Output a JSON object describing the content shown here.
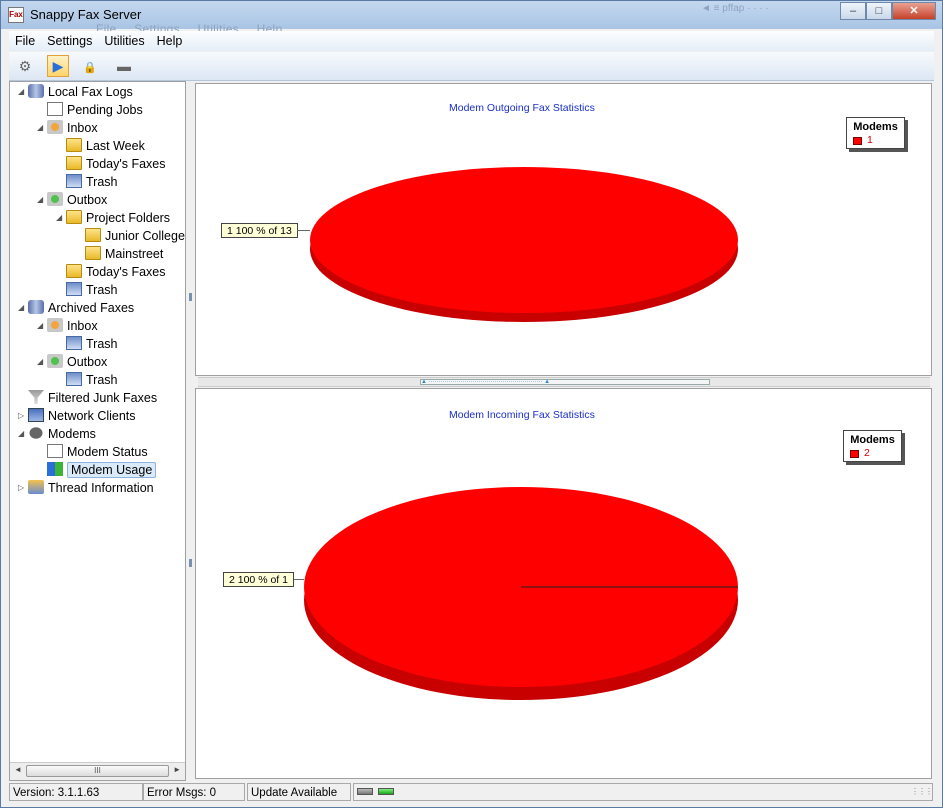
{
  "window": {
    "title": "Snappy Fax Server",
    "app_icon_text": "Fax",
    "ghost_menu": [
      "File",
      "Settings",
      "Utilities",
      "Help"
    ],
    "ghost_top_right": "◄ ≡ pffap   · · · ·",
    "minimize": "–",
    "maximize": "□",
    "close": "✕"
  },
  "menu": [
    "File",
    "Settings",
    "Utilities",
    "Help"
  ],
  "toolbar": {
    "buttons": [
      {
        "icon": "gear-icon",
        "glyph": "⚙"
      },
      {
        "icon": "play-icon",
        "glyph": "▶"
      },
      {
        "icon": "lock-icon",
        "glyph": "🔒"
      },
      {
        "icon": "modem-icon",
        "glyph": "▬"
      }
    ]
  },
  "tree": [
    {
      "label": "Local Fax Logs",
      "icon": "ic-db",
      "depth": 0,
      "exp": "◢"
    },
    {
      "label": "Pending Jobs",
      "icon": "ic-doc",
      "depth": 1,
      "exp": ""
    },
    {
      "label": "Inbox",
      "icon": "ic-inbox",
      "depth": 1,
      "exp": "◢"
    },
    {
      "label": "Last Week",
      "icon": "ic-folder",
      "depth": 2,
      "exp": ""
    },
    {
      "label": "Today's Faxes",
      "icon": "ic-folder",
      "depth": 2,
      "exp": ""
    },
    {
      "label": "Trash",
      "icon": "ic-trash",
      "depth": 2,
      "exp": ""
    },
    {
      "label": "Outbox",
      "icon": "ic-outbox",
      "depth": 1,
      "exp": "◢"
    },
    {
      "label": "Project Folders",
      "icon": "ic-folder",
      "depth": 2,
      "exp": "◢"
    },
    {
      "label": "Junior College",
      "icon": "ic-folder",
      "depth": 3,
      "exp": ""
    },
    {
      "label": "Mainstreet",
      "icon": "ic-folder",
      "depth": 3,
      "exp": ""
    },
    {
      "label": "Today's Faxes",
      "icon": "ic-folder",
      "depth": 2,
      "exp": ""
    },
    {
      "label": "Trash",
      "icon": "ic-trash",
      "depth": 2,
      "exp": ""
    },
    {
      "label": "Archived Faxes",
      "icon": "ic-db",
      "depth": 0,
      "exp": "◢"
    },
    {
      "label": "Inbox",
      "icon": "ic-inbox",
      "depth": 1,
      "exp": "◢"
    },
    {
      "label": "Trash",
      "icon": "ic-trash",
      "depth": 2,
      "exp": ""
    },
    {
      "label": "Outbox",
      "icon": "ic-outbox",
      "depth": 1,
      "exp": "◢"
    },
    {
      "label": "Trash",
      "icon": "ic-trash",
      "depth": 2,
      "exp": ""
    },
    {
      "label": "Filtered Junk Faxes",
      "icon": "ic-filter",
      "depth": 0,
      "exp": ""
    },
    {
      "label": "Network Clients",
      "icon": "ic-pc",
      "depth": 0,
      "exp": "▷"
    },
    {
      "label": "Modems",
      "icon": "ic-modem",
      "depth": 0,
      "exp": "◢"
    },
    {
      "label": "Modem  Status",
      "icon": "ic-doc",
      "depth": 1,
      "exp": ""
    },
    {
      "label": "Modem  Usage",
      "icon": "ic-usage",
      "depth": 1,
      "exp": "",
      "selected": true
    },
    {
      "label": "Thread Information",
      "icon": "ic-thread",
      "depth": 0,
      "exp": "▷"
    }
  ],
  "tree_scroll": {
    "left": "◄",
    "right": "►",
    "thumb": "III"
  },
  "charts": {
    "outgoing": {
      "title": "Modem Outgoing Fax Statistics",
      "legend_title": "Modems",
      "legend_label": "1",
      "slice_label": "1 100 % of 13",
      "color": "#ff0000"
    },
    "incoming": {
      "title": "Modem Incoming Fax Statistics",
      "legend_title": "Modems",
      "legend_label": "2",
      "slice_label": "2 100 % of 1",
      "color": "#ff0000"
    }
  },
  "chart_data": [
    {
      "type": "pie",
      "title": "Modem Outgoing Fax Statistics",
      "legend": {
        "title": "Modems",
        "placement": "top-right",
        "entries": [
          "1"
        ]
      },
      "categories": [
        "1"
      ],
      "values": [
        13
      ],
      "labels": [
        "1 100 % of 13"
      ],
      "percent": [
        100
      ]
    },
    {
      "type": "pie",
      "title": "Modem Incoming Fax Statistics",
      "legend": {
        "title": "Modems",
        "placement": "top-right",
        "entries": [
          "2"
        ]
      },
      "categories": [
        "2"
      ],
      "values": [
        1
      ],
      "labels": [
        "2 100 % of 1"
      ],
      "percent": [
        100
      ]
    }
  ],
  "status": {
    "version": "Version: 3.1.1.63",
    "errors": "Error Msgs: 0",
    "update": "Update Available"
  },
  "colors": {
    "slice": "#ff0000",
    "slice_side": "#c80000",
    "title_blue": "#1a2fc8"
  }
}
